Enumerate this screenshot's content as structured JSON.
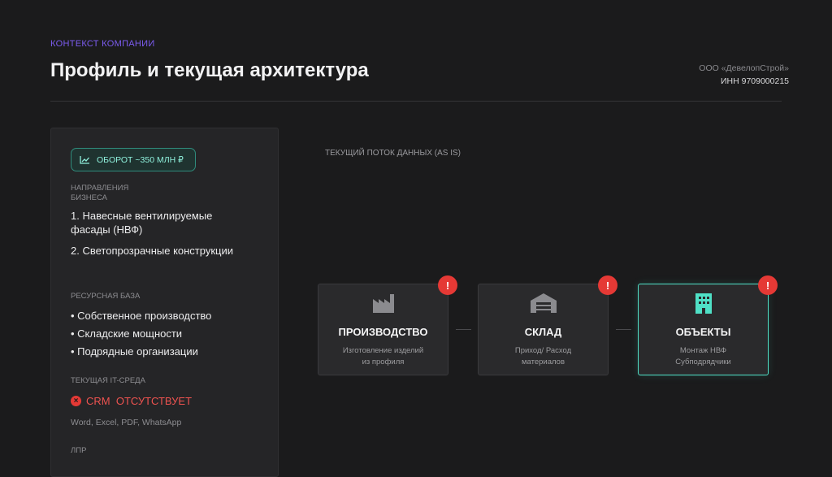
{
  "header": {
    "eyebrow": "КОНТЕКСТ КОМПАНИИ",
    "title": "Профиль и текущая архитектура",
    "company_name": "ООО «ДевелопСтрой»",
    "inn": "ИНН 9709000215"
  },
  "profile": {
    "turnover_badge": "ОБОРОТ ~350 МЛН ₽",
    "directions_label": "НАПРАВЛЕНИЯ БИЗНЕСА",
    "directions": [
      "1. Навесные вентилируемые фасады (НВФ)",
      "2. Светопрозрачные конструкции"
    ],
    "resources_label": "РЕСУРСНАЯ БАЗА",
    "resources": [
      "• Собственное производство",
      "• Складские мощности",
      "• Подрядные организации"
    ],
    "it_label": "ТЕКУЩАЯ IT-СРЕДА",
    "crm_status": "CRM  ОТСУТСТВУЕТ",
    "tools": "Word, Excel, PDF, WhatsApp",
    "lpr_label": "ЛПР"
  },
  "flow": {
    "label": "ТЕКУЩИЙ ПОТОК ДАННЫХ (AS IS)",
    "nodes": [
      {
        "name": "ПРОИЗВОДСТВО",
        "desc": "Изготовление изделий\nиз профиля",
        "icon": "factory-icon",
        "alert": "!"
      },
      {
        "name": "СКЛАД",
        "desc": "Приход/ Расход\nматериалов",
        "icon": "warehouse-icon",
        "alert": "!"
      },
      {
        "name": "ОБЪЕКТЫ",
        "desc": "Монтаж НВФ\nСубподрядчики",
        "icon": "building-icon",
        "alert": "!"
      }
    ]
  },
  "colors": {
    "accent_purple": "#7c5cf0",
    "accent_teal": "#4fe0c6",
    "alert_red": "#e53935"
  }
}
